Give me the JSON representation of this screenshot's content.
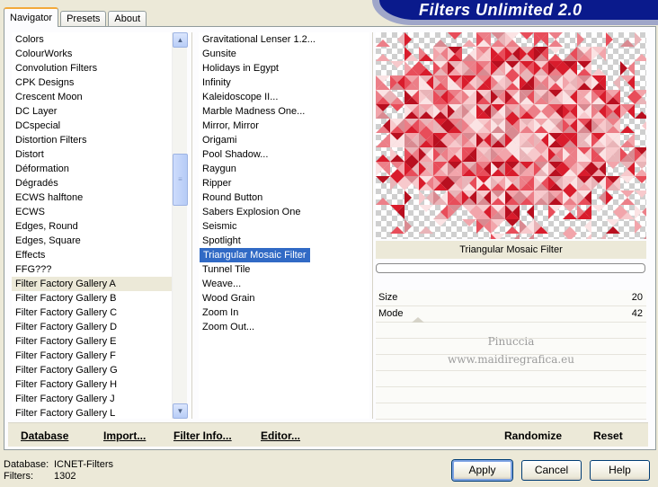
{
  "app": {
    "title": "Filters Unlimited 2.0"
  },
  "tabs": [
    {
      "label": "Navigator",
      "active": true
    },
    {
      "label": "Presets",
      "active": false
    },
    {
      "label": "About",
      "active": false
    }
  ],
  "categories": {
    "items": [
      "Colors",
      "ColourWorks",
      "Convolution Filters",
      "CPK Designs",
      "Crescent Moon",
      "DC Layer",
      "DCspecial",
      "Distortion Filters",
      "Distort",
      "Déformation",
      "Dégradés",
      "ECWS halftone",
      "ECWS",
      "Edges, Round",
      "Edges, Square",
      "Effects",
      "FFG???",
      "Filter Factory Gallery A",
      "Filter Factory Gallery B",
      "Filter Factory Gallery C",
      "Filter Factory Gallery D",
      "Filter Factory Gallery E",
      "Filter Factory Gallery F",
      "Filter Factory Gallery G",
      "Filter Factory Gallery H",
      "Filter Factory Gallery J",
      "Filter Factory Gallery L"
    ],
    "selected_index": 17
  },
  "filters": {
    "items": [
      "Gravitational Lenser 1.2...",
      "Gunsite",
      "Holidays in Egypt",
      "Infinity",
      "Kaleidoscope II...",
      "Marble Madness One...",
      "Mirror, Mirror",
      "Origami",
      "Pool Shadow...",
      "Raygun",
      "Ripper",
      "Round Button",
      "Sabers Explosion One",
      "Seismic",
      "Spotlight",
      "Triangular Mosaic Filter",
      "Tunnel Tile",
      "Weave...",
      "Wood Grain",
      "Zoom In",
      "Zoom Out..."
    ],
    "selected_index": 15
  },
  "preview": {
    "filter_name": "Triangular Mosaic Filter",
    "progress": 0
  },
  "params": [
    {
      "label": "Size",
      "value": "20"
    },
    {
      "label": "Mode",
      "value": "42"
    }
  ],
  "watermark": {
    "line1": "Pinuccia",
    "line2": "www.maidiregrafica.eu"
  },
  "links": {
    "database": "Database",
    "import": "Import...",
    "filter_info": "Filter Info...",
    "editor": "Editor...",
    "randomize": "Randomize",
    "reset": "Reset"
  },
  "info": {
    "database_label": "Database:",
    "database_value": "ICNET-Filters",
    "filters_label": "Filters:",
    "filters_value": "1302"
  },
  "buttons": {
    "apply": "Apply",
    "cancel": "Cancel",
    "help": "Help"
  },
  "colors": {
    "banner": "#0a1a8c",
    "selection": "#316ac5",
    "mosaic_base": "#e8414f"
  }
}
